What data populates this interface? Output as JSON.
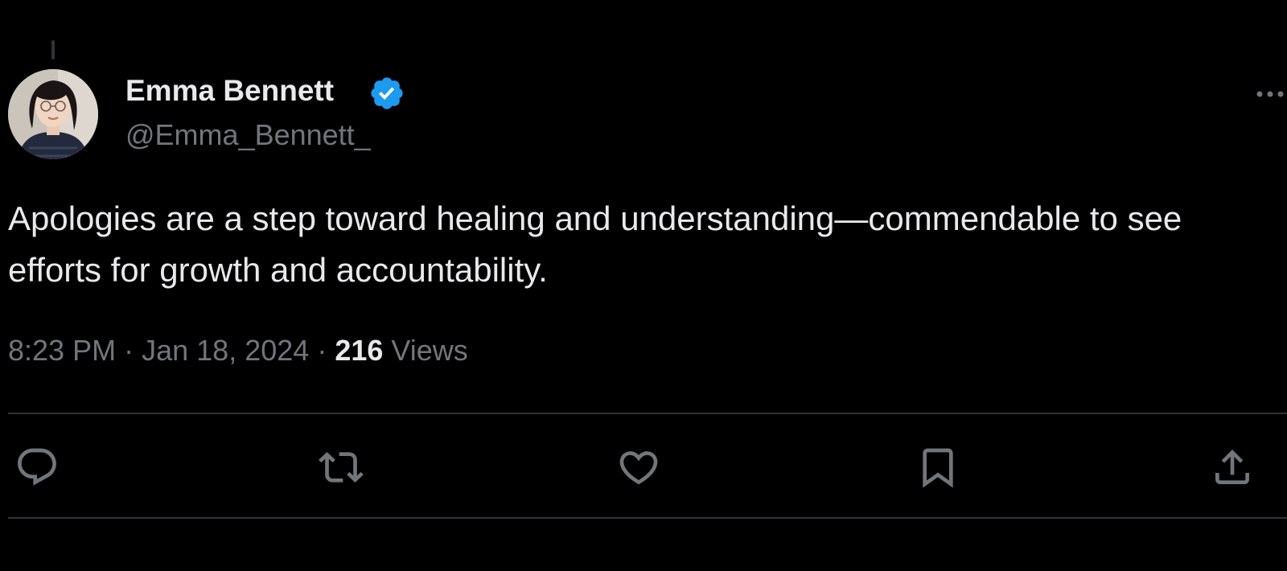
{
  "tweet": {
    "author": {
      "display_name": "Emma Bennett",
      "handle": "@Emma_Bennett_",
      "verified": true,
      "avatar_icon": "avatar-photo"
    },
    "text": "Apologies are a step toward healing and understanding—commendable to see efforts for growth and accountability.",
    "time": "8:23 PM",
    "separator": "·",
    "date": "Jan 18, 2024",
    "views_count": "216",
    "views_label": "Views"
  },
  "actions": [
    {
      "name": "reply",
      "icon": "reply-icon"
    },
    {
      "name": "retweet",
      "icon": "retweet-icon"
    },
    {
      "name": "like",
      "icon": "heart-icon"
    },
    {
      "name": "bookmark",
      "icon": "bookmark-icon"
    },
    {
      "name": "share",
      "icon": "share-icon"
    }
  ],
  "colors": {
    "background": "#000000",
    "primary_text": "#e7e9ea",
    "secondary_text": "#71767b",
    "divider": "#2f3336",
    "verified_blue": "#1d9bf0"
  }
}
